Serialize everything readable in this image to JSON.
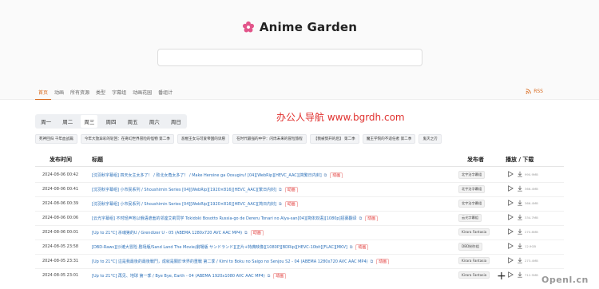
{
  "brand": {
    "title": "Anime Garden"
  },
  "search": {
    "placeholder": ""
  },
  "nav": {
    "items": [
      "首页",
      "动画",
      "所有资源",
      "类型",
      "字幕组",
      "动画花园",
      "番组计"
    ],
    "active_index": 0,
    "rss_label": "RSS"
  },
  "watermark": "办公人导航 www.bgrdh.com",
  "weekdays": {
    "items": [
      "周一",
      "周二",
      "周三",
      "周四",
      "周五",
      "周六",
      "周日"
    ],
    "selected_index": 2
  },
  "chips": [
    "死神回归 千年血战篇",
    "今年大放异彩的轮回：在奇幻世界冒险的怪物 第二季",
    "恶棍王女与可爱帝国的诉愿",
    "在时代最强的中学：闪烁未来的冒险旅程",
    "【我被劈开的后】 第二季",
    "魔王学院的不适任者 第二季",
    "鬼灭之刃"
  ],
  "table": {
    "headers": {
      "time": "发布时间",
      "title": "标题",
      "publisher": "发布者",
      "actions": "播放 / 下载"
    },
    "rows": [
      {
        "date": "2024-08-06 00:42",
        "title": "[沈羽秋字幕组] 四天女主太多了！ / 败北女角太多了！ / Make Heroine ga Oosugiru! [04][WebRip][HEVC_AAC][简繁日内封]",
        "tag": "动画",
        "publisher": "北宇治字幕组",
        "size": "990.9MB"
      },
      {
        "date": "2024-08-06 00:41",
        "title": "[沈羽秋字幕组] 小市民系列 / Shoushimin Series [04][WebRip][1920×816][HEVC_AAC][繁日内封]",
        "tag": "动画",
        "publisher": "北宇治字幕组",
        "size": "366.4MB"
      },
      {
        "date": "2024-08-06 00:39",
        "title": "[沈羽秋字幕组] 小市民系列 / Shoushimin Series [04][WebRip][1920×816][HEVC_AAC][简日内封]",
        "tag": "动画",
        "publisher": "北宇治字幕组",
        "size": "366.4MB"
      },
      {
        "date": "2024-08-06 00:06",
        "title": "[云光字幕组] 不时轻声地以俄语遮羞的邻座艾莉同学 Tokidoki Bosotto Russia-go de Dereru Tonari no Alya-san[04][简体双语][1080p]招募翻译",
        "tag": "动画",
        "publisher": "云光字幕组",
        "size": "334.7MB"
      },
      {
        "date": "2024-08-06 00:01",
        "title": "[Up to 21°C] 杀魂第的U / Grendizer U - 05 (ABEMA 1280x720 AVC AAC MP4)",
        "tag": "动画",
        "publisher": "Kirara Fantasia",
        "size": "270.8MB"
      },
      {
        "date": "2024-08-05 23:58",
        "title": "[DBD-Raws][沙滩大冒险 剧场版/Sand Land The Movie/劇場版 サンドランド][正片+特典映像][1080P][BDRip][HEVC-10bit][FLAC][MKV]",
        "tag": "动画",
        "publisher": "DBD制作组",
        "size": "12.9GB"
      },
      {
        "date": "2024-08-05 23:31",
        "title": "[Up to 21°C] 這是我最後的最後戰鬥，成就是關於世界的重戰 第二季 / Kimi to Boku no Saigo no Senjou S2 - 04 (ABEMA 1280x720 AVC AAC MP4)",
        "tag": "动画",
        "publisher": "Kirara Fantasia",
        "size": "273.4MB"
      },
      {
        "date": "2024-08-05 23:01",
        "title": "[Up to 21°C] 再见、地球 第一季 / Bye Bye, Earth - 04 (ABEMA 1920x1080 AVC AAC MP4)",
        "tag": "动画",
        "publisher": "Kirara Fantasia",
        "size": "712.5MB"
      }
    ]
  },
  "corner_mark": "Openl.cn",
  "colors": {
    "accent": "#d96b1f",
    "link": "#2a6fb8",
    "tag": "#e0312f",
    "logo": "#e2558a"
  }
}
